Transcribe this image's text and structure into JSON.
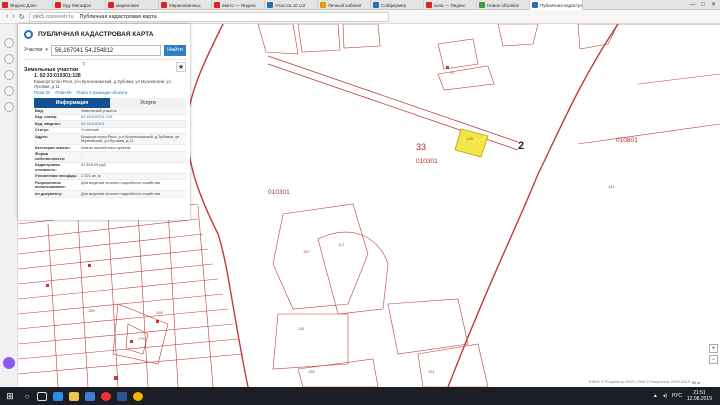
{
  "browser": {
    "tabs": [
      {
        "label": "Яндекс.Дзен",
        "color": "#e02020"
      },
      {
        "label": "Egy Мегафон",
        "color": "#e02020"
      },
      {
        "label": "мариновае",
        "color": "#e02020"
      },
      {
        "label": "Маринованных",
        "color": "#e02020"
      },
      {
        "label": "авито — Яндекс",
        "color": "#e02020"
      },
      {
        "label": "Участок 10 сот",
        "color": "#2a6fb1"
      },
      {
        "label": "Личный кабинет",
        "color": "#e2a000"
      },
      {
        "label": "Собфермер",
        "color": "#2a6fb1"
      },
      {
        "label": "кола — Яндекс",
        "color": "#e02020"
      },
      {
        "label": "Новое объявле",
        "color": "#35a335"
      },
      {
        "label": "Публичная кадастровая",
        "color": "#2a6fb1",
        "active": true
      }
    ],
    "url_host": "pkk5.rosreestr.ru",
    "page_title": "Публичная кадастровая карта"
  },
  "panel": {
    "title": "ПУБЛИЧНАЯ КАДАСТРОВАЯ КАРТА",
    "search_type": "Участки",
    "search_value": "56,167041 54,254812",
    "search_button": "Найти",
    "layer_name": "Земельные участки",
    "layer_count": "1",
    "result": {
      "index": "1.",
      "number": "02:33:010301:128",
      "address": "Башкортостан Респ, р-н Краснокамский, д Зубовка, ул Музеевский, ул Луговая, д 11",
      "link1": "План ЗУ",
      "link2": "План КК",
      "link3": "Поиск в границах объекта"
    },
    "tabs": {
      "info": "Информация",
      "services": "Услуги"
    },
    "info_rows": [
      {
        "k": "Вид:",
        "v": "Земельный участок",
        "link": false
      },
      {
        "k": "Кад. номер:",
        "v": "02:33:010301:128",
        "link": true
      },
      {
        "k": "Кад. квартал:",
        "v": "02:33:010301",
        "link": true
      },
      {
        "k": "Статус:",
        "v": "Учтенный",
        "link": false
      },
      {
        "k": "Адрес:",
        "v": "Башкортостан Респ, р-н Краснокамский, д Зубовка, ул Музеевский, ул Луговая, д 11",
        "link": false
      },
      {
        "k": "Категория земель:",
        "v": "Земли населённых пунктов",
        "link": false
      },
      {
        "k": "Форма собственности:",
        "v": "-",
        "link": false
      },
      {
        "k": "Кадастровая стоимость:",
        "v": "57 818,99 руб.",
        "link": false
      },
      {
        "k": "Уточненная площадь:",
        "v": "1 221 кв. м",
        "link": false
      },
      {
        "k": "Разрешенное использование:",
        "v": "Для ведения личного подсобного хозяйства",
        "link": false
      },
      {
        "k": "по документу:",
        "v": "Для ведения личного подсобного хозяйства",
        "link": false
      }
    ]
  },
  "map": {
    "labels": {
      "l33": "33",
      "l2": "2",
      "q010301a": "010301",
      "q010301b": "010301",
      "q010801": "010801",
      "p157": "157",
      "p117": "117",
      "p116": "116",
      "p135": "135",
      "p131": "131",
      "p141": "141",
      "p91": "91",
      "p150": "150",
      "p158": "158",
      "p128": "128",
      "p417": "417",
      "p176": "176",
      "p52": "52"
    },
    "attribution": "ЕЭКО © Росреестр 2010 | ПКК © Росреестр 2010-2019",
    "scale": "50 м"
  },
  "taskbar": {
    "time": "21:51",
    "date": "12.08.2019",
    "lang": "РУС"
  }
}
